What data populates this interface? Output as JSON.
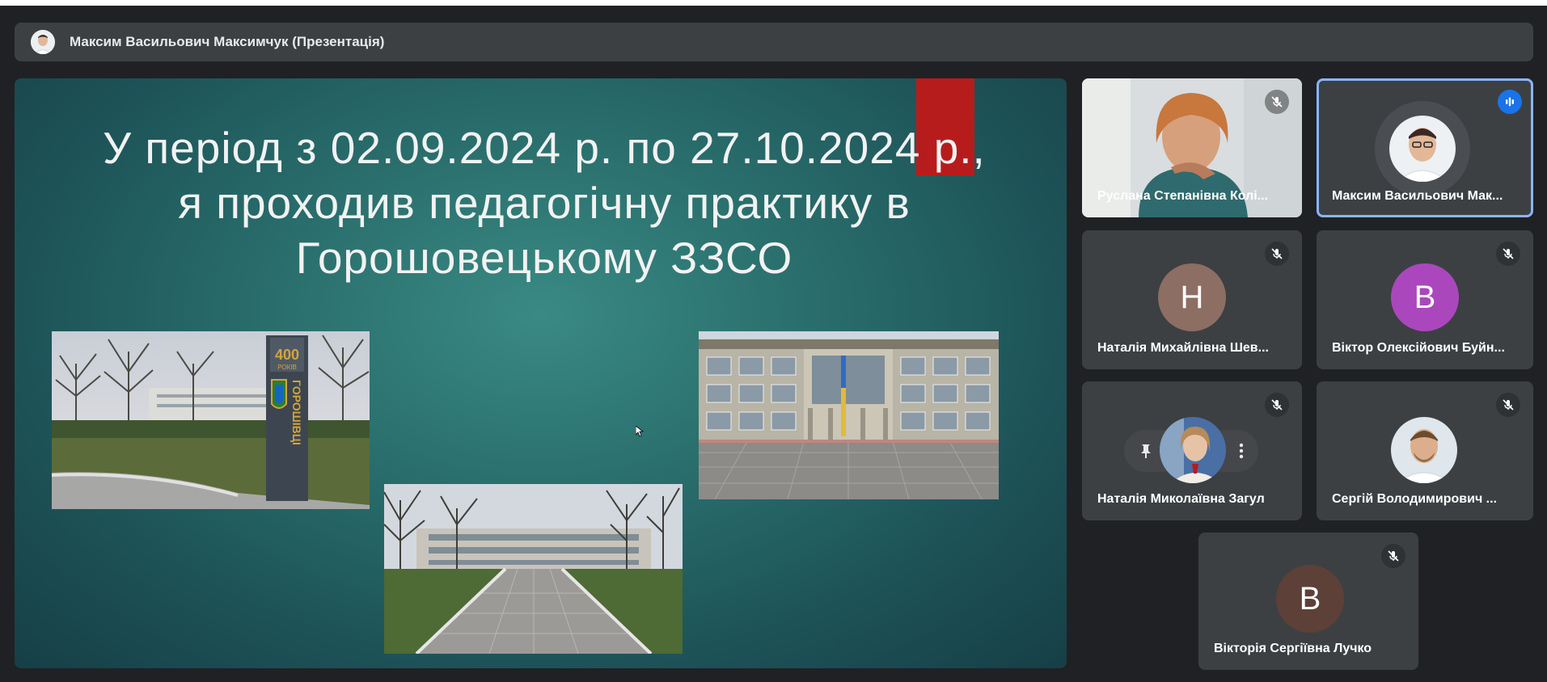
{
  "presenter_bar": {
    "label": "Максим Васильович Максимчук (Презентація)"
  },
  "slide": {
    "title_lines": [
      "У період з 02.09.2024 р. по 27.10.2024 р.,",
      "я проходив педагогічну практику в",
      "Горошовецькому ЗЗСО"
    ],
    "photos": [
      "village-sign-photo",
      "school-building-photo",
      "school-alley-photo"
    ],
    "sign_text": {
      "number": "400",
      "word": "ГОРОШІВЦІ",
      "small": "РОКІВ"
    }
  },
  "participants": [
    {
      "name": "Руслана Степанівна Колі...",
      "type": "video",
      "muted": true
    },
    {
      "name": "Максим Васильович Мак...",
      "type": "photo",
      "speaking": true
    },
    {
      "name": "Наталія Михайлівна Шев...",
      "type": "letter",
      "letter": "Н",
      "color": "#8d6e63",
      "muted": true
    },
    {
      "name": "Віктор Олексійович Буйн...",
      "type": "letter",
      "letter": "В",
      "color": "#ab47bc",
      "muted": true
    },
    {
      "name": "Наталія Миколаївна Загул",
      "type": "photo",
      "muted": true,
      "pin_menu": true
    },
    {
      "name": "Сергій Володимирович ...",
      "type": "photo",
      "muted": true
    },
    {
      "name": "Вікторія Сергіївна Лучко",
      "type": "letter",
      "letter": "В",
      "color": "#5d4037",
      "muted": true
    }
  ],
  "colors": {
    "background": "#202124",
    "tile": "#3c4043",
    "accent": "#8ab4f8",
    "speaking": "#1a73e8"
  }
}
